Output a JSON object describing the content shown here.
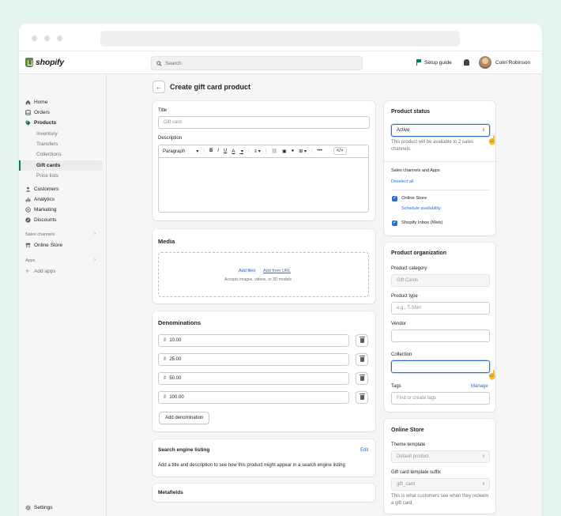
{
  "app": {
    "brand": "shopify",
    "user_name": "Colin Robinson",
    "accent": "#008060",
    "focus_color": "#2c6ecb"
  },
  "search": {
    "placeholder": "Search"
  },
  "header": {
    "setup_guide": "Setup guide"
  },
  "sidebar": {
    "items": [
      {
        "label": "Home",
        "icon": "home-icon"
      },
      {
        "label": "Orders",
        "icon": "orders-icon"
      },
      {
        "label": "Products",
        "icon": "tag-icon"
      }
    ],
    "product_sub": [
      "Inventory",
      "Transfers",
      "Collections",
      "Gift cards",
      "Price lists"
    ],
    "items2": [
      {
        "label": "Customers",
        "icon": "person-icon"
      },
      {
        "label": "Analytics",
        "icon": "bar-chart-icon"
      },
      {
        "label": "Marketing",
        "icon": "target-icon"
      },
      {
        "label": "Discounts",
        "icon": "discount-icon"
      }
    ],
    "sales_channels_label": "Sales channels",
    "online_store": "Online Store",
    "apps_label": "Apps",
    "add_apps": "Add apps",
    "settings": "Settings"
  },
  "page": {
    "title": "Create gift card product"
  },
  "details_card": {
    "title_label": "Title",
    "title_placeholder": "Gift card",
    "description_label": "Description",
    "toolbar": {
      "format": "Paragraph",
      "bold": "B",
      "italic": "I",
      "underline": "U",
      "color": "A",
      "more": "•••",
      "code": "</>"
    }
  },
  "media": {
    "title": "Media",
    "add_files": "Add files",
    "add_from_url": "Add from URL",
    "hint": "Accepts images, videos, or 3D models"
  },
  "denominations": {
    "title": "Denominations",
    "currency_symbol": "₴",
    "values": [
      "10.00",
      "25.00",
      "50.00",
      "100.00"
    ],
    "add_button": "Add denomination"
  },
  "seo": {
    "title": "Search engine listing",
    "edit": "Edit",
    "text": "Add a title and description to see how this product might appear in a search engine listing"
  },
  "metafields": {
    "title": "Metafields"
  },
  "status": {
    "title": "Product status",
    "value": "Active",
    "hint": "This product will be available to 2 sales channels.",
    "channels_label": "Sales channels and Apps",
    "deselect_all": "Deselect all",
    "channel1": "Online Store",
    "schedule": "Schedule availability",
    "channel2": "Shopify Inbox (Web)"
  },
  "organization": {
    "title": "Product organization",
    "category_label": "Product category",
    "category_value": "Gift Cards",
    "type_label": "Product type",
    "type_placeholder": "e.g., T-Shirt",
    "vendor_label": "Vendor",
    "collection_label": "Collection",
    "tags_label": "Tags",
    "manage": "Manage",
    "tags_placeholder": "Find or create tags"
  },
  "online_store": {
    "title": "Online Store",
    "theme_label": "Theme template",
    "theme_value": "Default product",
    "suffix_label": "Gift card template suffix",
    "suffix_value": "gift_card",
    "hint": "This is what customers see when they redeem a gift card."
  }
}
